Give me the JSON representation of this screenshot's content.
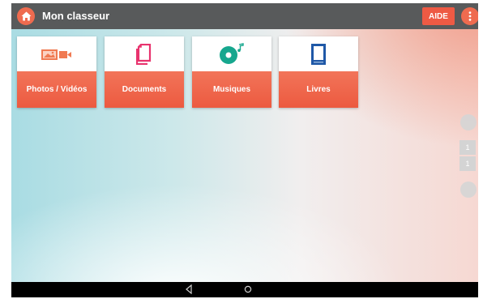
{
  "header": {
    "title": "Mon classeur",
    "help_label": "AIDE"
  },
  "tiles": [
    {
      "label": "Photos / Vidéos",
      "icon": "photo-video-icon",
      "color": "#f07a52"
    },
    {
      "label": "Documents",
      "icon": "document-icon",
      "color": "#e8336e"
    },
    {
      "label": "Musiques",
      "icon": "music-disc-icon",
      "color": "#16a78e"
    },
    {
      "label": "Livres",
      "icon": "book-icon",
      "color": "#1f58a7"
    }
  ],
  "pager": {
    "current_page": "1",
    "total_pages": "1"
  },
  "colors": {
    "accent": "#ee5a44",
    "topbar": "#585a5b"
  }
}
